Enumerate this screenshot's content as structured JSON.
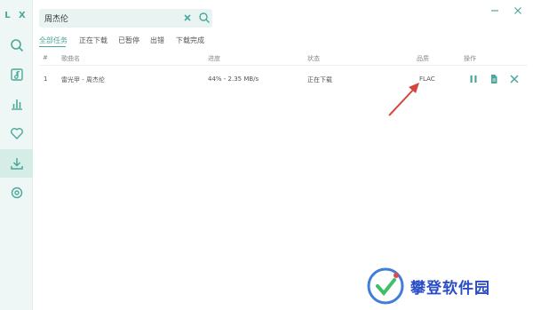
{
  "app": {
    "logo": "L X"
  },
  "sidebar": {
    "items": [
      {
        "name": "search",
        "icon": "search-icon"
      },
      {
        "name": "song-list",
        "icon": "music-note-icon"
      },
      {
        "name": "leaderboard",
        "icon": "bar-chart-icon"
      },
      {
        "name": "favorites",
        "icon": "heart-icon"
      },
      {
        "name": "downloads",
        "icon": "download-icon",
        "active": true
      },
      {
        "name": "settings",
        "icon": "gear-icon"
      }
    ]
  },
  "search": {
    "value": "周杰伦"
  },
  "tabs": [
    {
      "label": "全部任务",
      "active": true
    },
    {
      "label": "正在下载"
    },
    {
      "label": "已暂停"
    },
    {
      "label": "出错"
    },
    {
      "label": "下载完成"
    }
  ],
  "table": {
    "headers": [
      "#",
      "歌曲名",
      "进度",
      "状态",
      "品质",
      "操作"
    ],
    "rows": [
      {
        "index": "1",
        "song": "雷光甲 - 周杰伦",
        "progress": "44% - 2.35 MB/s",
        "status": "正在下载",
        "quality": "FLAC"
      }
    ]
  },
  "colors": {
    "accent": "#4aa89a",
    "arrow": "#d6453a",
    "watermark": "#2a4cc6"
  },
  "watermark": {
    "text": "攀登软件园"
  }
}
